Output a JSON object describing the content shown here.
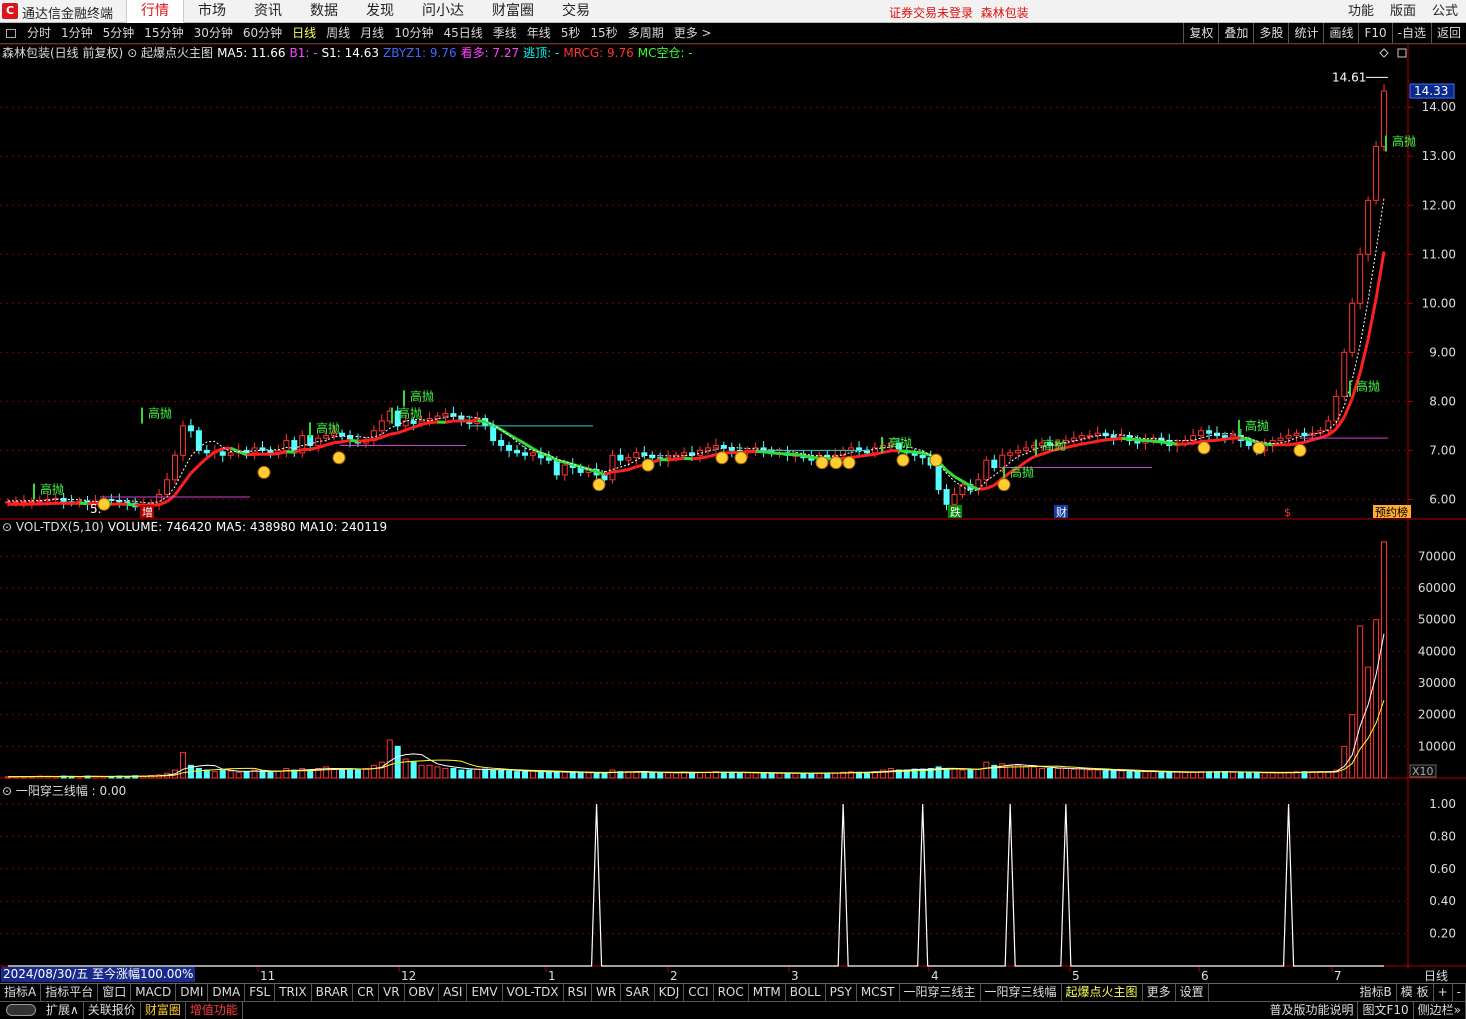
{
  "app": {
    "logo": "C",
    "title": "通达信金融终端",
    "menu": [
      "行情",
      "市场",
      "资讯",
      "数据",
      "发现",
      "问小达",
      "财富圈",
      "交易"
    ],
    "active_menu": "行情",
    "notice": "证券交易未登录",
    "stock_name": "森林包装",
    "right_menu": [
      "功能",
      "版面",
      "公式"
    ]
  },
  "periods": [
    "分时",
    "1分钟",
    "5分钟",
    "15分钟",
    "30分钟",
    "60分钟",
    "日线",
    "周线",
    "月线",
    "10分钟",
    "45日线",
    "季线",
    "年线",
    "5秒",
    "15秒",
    "多周期",
    "更多 >"
  ],
  "active_period": "日线",
  "tools": [
    "复权",
    "叠加",
    "多股",
    "统计",
    "画线",
    "F10",
    "-自选",
    "返回"
  ],
  "main_info": [
    {
      "t": "森林包装(日线 前复权)",
      "c": "#dddddd"
    },
    {
      "t": "⊙ 起爆点火主图",
      "c": "#dddddd"
    },
    {
      "t": "MA5: 11.66",
      "c": "#ffffff"
    },
    {
      "t": "B1: -",
      "c": "#ff44ff"
    },
    {
      "t": "S1: 14.63",
      "c": "#ffffff"
    },
    {
      "t": "ZBYZ1: 9.76",
      "c": "#3a6bff"
    },
    {
      "t": "看多: 7.27",
      "c": "#ff44ff"
    },
    {
      "t": "逃顶: -",
      "c": "#00ffff"
    },
    {
      "t": "MRCG: 9.76",
      "c": "#ff3333"
    },
    {
      "t": "MC空仓: -",
      "c": "#33ff33"
    }
  ],
  "vol_info": [
    {
      "t": "⊙ VOL-TDX(5,10)",
      "c": "#dddddd"
    },
    {
      "t": "VOLUME: 746420",
      "c": "#ffffff"
    },
    {
      "t": "MA5: 438980",
      "c": "#ffffff"
    },
    {
      "t": "MA10: 240119",
      "c": "#ffffff"
    }
  ],
  "ind_info": [
    {
      "t": "⊙ 一阳穿三线幅 : 0.00",
      "c": "#dddddd"
    }
  ],
  "price_axis": [
    "14.00",
    "13.00",
    "12.00",
    "11.00",
    "10.00",
    "9.00",
    "8.00",
    "7.00",
    "6.00"
  ],
  "price_tag": "14.33",
  "high_label": "14.61",
  "low_label": "5.",
  "vol_axis": [
    "70000",
    "60000",
    "50000",
    "40000",
    "30000",
    "20000",
    "10000"
  ],
  "vol_unit": "X10",
  "ind_axis": [
    "1.00",
    "0.80",
    "0.60",
    "0.40",
    "0.20"
  ],
  "signal_label": "高抛",
  "markers": [
    "增",
    "跌",
    "财",
    "$",
    "预约榜"
  ],
  "month_labels": [
    "11",
    "12",
    "1",
    "2",
    "3",
    "4",
    "5",
    "6",
    "7"
  ],
  "date_box": "2024/08/30/五 至今涨幅100.00%",
  "axis_bottom": "日线",
  "tabs": [
    "指标A",
    "指标平台",
    "窗口",
    "MACD",
    "DMI",
    "DMA",
    "FSL",
    "TRIX",
    "BRAR",
    "CR",
    "VR",
    "OBV",
    "ASI",
    "EMV",
    "VOL-TDX",
    "RSI",
    "WR",
    "SAR",
    "KDJ",
    "CCI",
    "ROC",
    "MTM",
    "BOLL",
    "PSY",
    "MCST",
    "一阳穿三线主",
    "一阳穿三线幅",
    "起爆点火主图",
    "更多",
    "设置"
  ],
  "active_tab": "起爆点火主图",
  "tabs_right": [
    "指标B",
    "模 板",
    "+",
    "-"
  ],
  "status": [
    {
      "t": "扩展∧",
      "c": "#dddddd"
    },
    {
      "t": "关联报价",
      "c": "#dddddd"
    },
    {
      "t": "财富圈",
      "c": "#ffcc33"
    },
    {
      "t": "增值功能",
      "c": "#ff3b3b"
    }
  ],
  "status_right": [
    "普及版功能说明",
    "图文F10",
    "侧边栏»"
  ],
  "colors": {
    "up": "#ff3232",
    "down": "#54ffff",
    "ma_red": "#ff2020",
    "ma_green": "#33dd33",
    "grid": "#7a0000"
  },
  "chart_data": {
    "type": "candlestick",
    "price_axis_range": [
      5.6,
      14.8
    ],
    "close_series": [
      5.95,
      5.95,
      5.95,
      5.96,
      5.97,
      6.0,
      6.02,
      5.95,
      5.94,
      5.96,
      5.9,
      5.95,
      6.0,
      5.98,
      5.95,
      5.92,
      5.85,
      5.88,
      5.92,
      6.1,
      6.4,
      6.9,
      7.5,
      7.4,
      7.0,
      6.95,
      6.97,
      6.9,
      6.95,
      7.0,
      6.95,
      7.05,
      7.0,
      6.95,
      7.0,
      7.2,
      6.95,
      7.3,
      7.1,
      7.25,
      7.3,
      7.35,
      7.3,
      7.2,
      7.15,
      7.2,
      7.4,
      7.6,
      7.8,
      7.5,
      7.6,
      7.55,
      7.6,
      7.65,
      7.7,
      7.75,
      7.7,
      7.6,
      7.55,
      7.65,
      7.5,
      7.2,
      7.1,
      7.0,
      6.95,
      6.9,
      6.95,
      6.85,
      6.8,
      6.5,
      6.7,
      6.65,
      6.55,
      6.6,
      6.5,
      6.4,
      6.9,
      6.8,
      6.85,
      6.95,
      6.9,
      6.85,
      6.8,
      6.85,
      6.9,
      6.95,
      6.9,
      7.0,
      7.05,
      7.1,
      7.05,
      7.0,
      6.95,
      7.0,
      7.05,
      7.0,
      6.95,
      6.95,
      6.9,
      6.9,
      6.85,
      6.8,
      6.9,
      6.85,
      6.9,
      7.0,
      7.05,
      7.0,
      6.95,
      7.05,
      7.1,
      7.15,
      7.0,
      6.95,
      6.9,
      6.85,
      6.7,
      6.2,
      5.9,
      6.1,
      6.3,
      6.2,
      6.4,
      6.8,
      6.65,
      6.9,
      6.95,
      7.0,
      7.05,
      7.1,
      7.15,
      7.1,
      7.15,
      7.2,
      7.25,
      7.3,
      7.3,
      7.35,
      7.3,
      7.25,
      7.3,
      7.2,
      7.15,
      7.2,
      7.25,
      7.2,
      7.1,
      7.15,
      7.2,
      7.3,
      7.4,
      7.35,
      7.3,
      7.25,
      7.3,
      7.2,
      7.1,
      7.0,
      7.1,
      7.2,
      7.25,
      7.3,
      7.35,
      7.3,
      7.35,
      7.4,
      7.6,
      8.1,
      9.0,
      10.0,
      11.0,
      12.1,
      13.2,
      14.33
    ],
    "volume_series": [
      0.4,
      0.5,
      0.4,
      0.5,
      0.6,
      0.5,
      0.4,
      0.6,
      0.5,
      0.4,
      0.6,
      0.5,
      0.4,
      0.5,
      0.6,
      0.5,
      0.7,
      0.6,
      0.8,
      1.0,
      1.5,
      2.5,
      8.0,
      4.0,
      3.0,
      2.5,
      2.0,
      2.4,
      2.2,
      1.8,
      2.0,
      2.5,
      2.2,
      1.8,
      2.2,
      3.0,
      2.5,
      3.0,
      2.5,
      3.0,
      3.5,
      3.0,
      2.8,
      2.5,
      2.5,
      3.0,
      4.0,
      5.0,
      12.0,
      10.0,
      6.0,
      5.0,
      4.0,
      4.0,
      3.5,
      3.0,
      3.0,
      2.5,
      2.5,
      2.8,
      2.8,
      2.5,
      2.5,
      2.2,
      2.0,
      2.0,
      2.2,
      1.8,
      1.8,
      2.0,
      1.8,
      1.8,
      1.6,
      1.6,
      1.5,
      1.5,
      2.5,
      2.0,
      2.0,
      2.0,
      1.8,
      1.8,
      1.6,
      1.6,
      1.6,
      1.8,
      1.8,
      1.8,
      1.8,
      2.0,
      1.8,
      1.8,
      1.6,
      1.6,
      1.6,
      1.6,
      1.5,
      1.5,
      1.5,
      1.5,
      1.5,
      1.5,
      1.6,
      1.6,
      1.6,
      1.8,
      2.0,
      1.8,
      1.8,
      2.0,
      2.5,
      3.0,
      2.5,
      2.5,
      2.8,
      2.8,
      3.0,
      3.5,
      3.0,
      2.8,
      2.5,
      2.5,
      2.8,
      5.0,
      4.0,
      4.5,
      4.0,
      4.0,
      3.5,
      3.5,
      3.0,
      3.0,
      3.0,
      3.0,
      2.8,
      2.8,
      2.5,
      2.5,
      2.5,
      2.2,
      2.2,
      2.0,
      2.0,
      2.0,
      2.0,
      1.8,
      1.8,
      1.8,
      1.8,
      1.8,
      2.0,
      2.0,
      2.0,
      2.0,
      1.8,
      1.8,
      1.8,
      1.6,
      1.6,
      1.6,
      1.6,
      1.8,
      2.0,
      2.0,
      2.0,
      2.0,
      2.0,
      2.5,
      10.0,
      20.0,
      48.0,
      35.0,
      50.0,
      74.6
    ],
    "indicator_series_spikes_at": [
      74,
      105,
      115,
      126,
      133,
      161
    ],
    "ma_line_colors": [
      "#ff2020",
      "#33dd33"
    ]
  }
}
